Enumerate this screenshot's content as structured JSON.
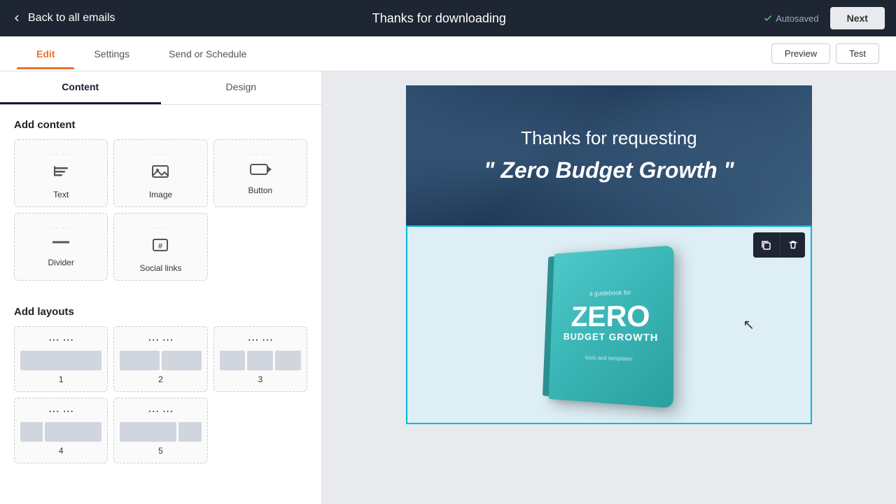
{
  "topbar": {
    "back_label": "Back to all emails",
    "title": "Thanks for downloading",
    "autosaved": "Autosaved",
    "next_label": "Next"
  },
  "tabs": {
    "items": [
      {
        "label": "Edit",
        "active": true
      },
      {
        "label": "Settings",
        "active": false
      },
      {
        "label": "Send or Schedule",
        "active": false
      }
    ],
    "preview_label": "Preview",
    "test_label": "Test"
  },
  "sidebar": {
    "tab_content": "Content",
    "tab_design": "Design",
    "add_content_title": "Add content",
    "content_items": [
      {
        "label": "Text",
        "icon": "¶"
      },
      {
        "label": "Image",
        "icon": "🖼"
      },
      {
        "label": "Button",
        "icon": "▬"
      }
    ],
    "content_items_row2": [
      {
        "label": "Divider",
        "icon": "—"
      },
      {
        "label": "Social links",
        "icon": "#"
      }
    ],
    "add_layouts_title": "Add layouts",
    "layout_items": [
      {
        "label": "1",
        "cols": [
          1
        ]
      },
      {
        "label": "2",
        "cols": [
          0.48,
          0.48
        ]
      },
      {
        "label": "3",
        "cols": [
          0.3,
          0.3,
          0.3
        ]
      }
    ]
  },
  "canvas": {
    "hero_title": "Thanks for requesting",
    "hero_subtitle": "\" Zero Budget Growth \"",
    "book_small_text": "a guidebook for",
    "book_zero": "ZERO",
    "book_budget": "BUDGET GROWTH",
    "book_bottom_text": "tools and templates"
  },
  "toolbar": {
    "copy_icon": "⧉",
    "delete_icon": "🗑"
  }
}
